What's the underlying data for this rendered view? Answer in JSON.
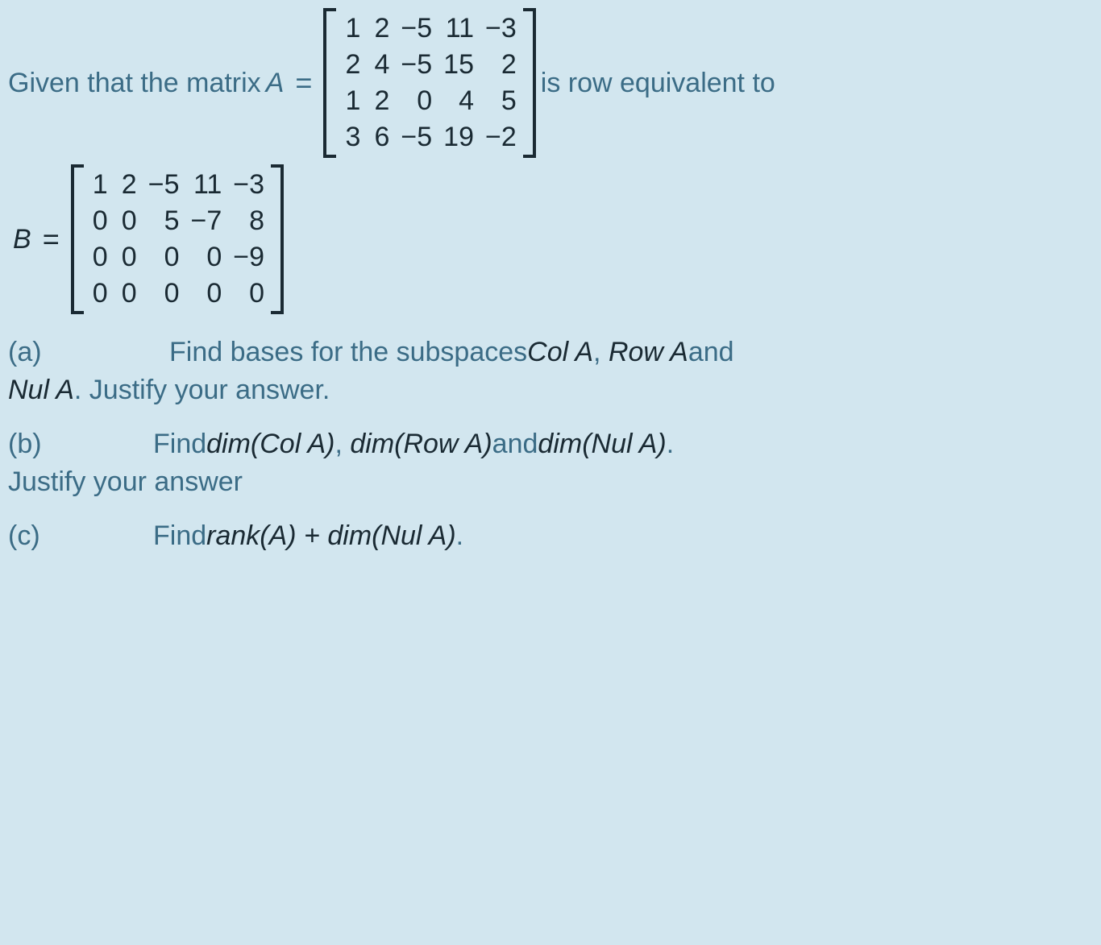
{
  "line1": {
    "prefix": "Given that the matrix ",
    "var": "A",
    "eq": "=",
    "suffix": " is row equivalent to"
  },
  "matrixA": {
    "cols": 5,
    "cells": [
      "1",
      "2",
      "−5",
      "11",
      "−3",
      "2",
      "4",
      "−5",
      "15",
      "2",
      "1",
      "2",
      "0",
      "4",
      "5",
      "3",
      "6",
      "−5",
      "19",
      "−2"
    ]
  },
  "line2": {
    "var": "B",
    "eq": "="
  },
  "matrixB": {
    "cols": 5,
    "cells": [
      "1",
      "2",
      "−5",
      "11",
      "−3",
      "0",
      "0",
      "5",
      "−7",
      "8",
      "0",
      "0",
      "0",
      "0",
      "−9",
      "0",
      "0",
      "0",
      "0",
      "0"
    ]
  },
  "partA": {
    "label": "(a)",
    "t1": "Find bases for the subspaces ",
    "m1": "Col A",
    "c1": ", ",
    "m2": "Row A",
    "t2": " and",
    "m3": "Nul A",
    "t3": ". Justify your answer."
  },
  "partB": {
    "label": "(b)",
    "t1": "Find ",
    "m1": "dim(Col A)",
    "c1": ", ",
    "m2": "dim(Row A)",
    "t2": " and ",
    "m3": "dim(Nul A)",
    "t3": ".",
    "t4": "Justify your answer"
  },
  "partC": {
    "label": "(c)",
    "t1": "Find ",
    "m1": "rank(A) + dim(Nul A)",
    "t2": "."
  }
}
